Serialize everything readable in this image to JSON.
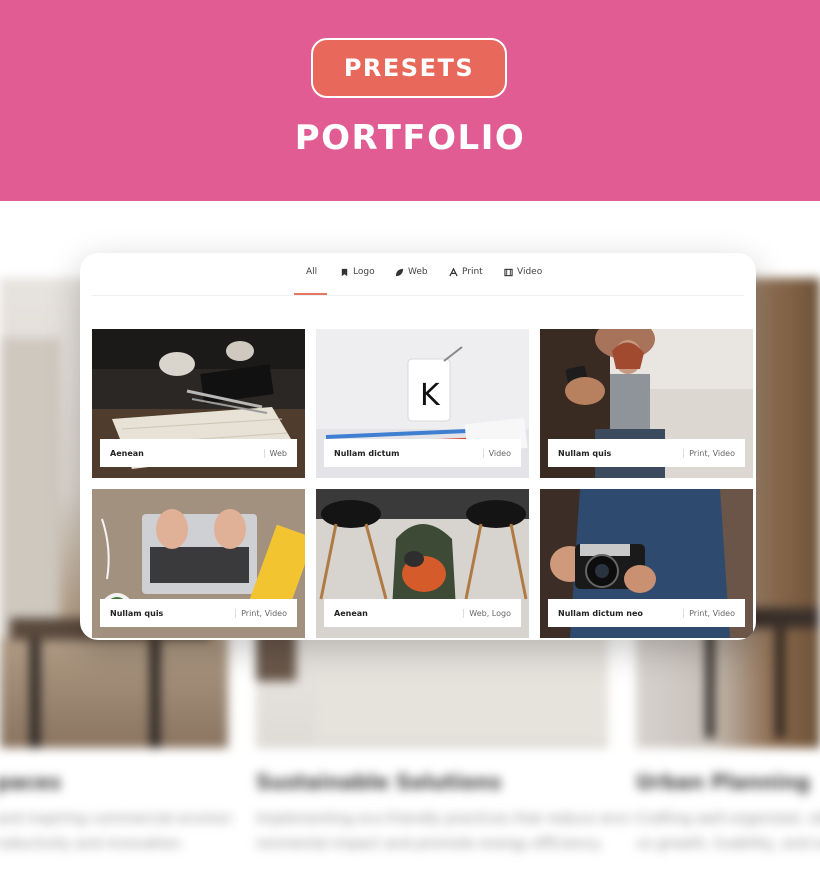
{
  "header": {
    "badge": "PRESETS",
    "title": "PORTFOLIO",
    "band_color": "#e05c93",
    "badge_color": "#e8685b"
  },
  "background": {
    "columns": [
      {
        "title": "paces",
        "desc_line1": "and inspiring commercial environ-",
        "desc_line2": "roductivity and innovation."
      },
      {
        "title": "Sustainable Solutions",
        "desc_line1": "Implementing eco-friendly practices that reduce envi-",
        "desc_line2": "ronmental impact and promote energy efficiency."
      },
      {
        "title": "Urban Planning",
        "desc_line1": "Crafting well-organized, vibr",
        "desc_line2": "ce growth, livability, and sust"
      }
    ]
  },
  "filters": [
    {
      "label": "All",
      "icon": "",
      "active": true
    },
    {
      "label": "Logo",
      "icon": "bookmark-icon"
    },
    {
      "label": "Web",
      "icon": "leaf-icon"
    },
    {
      "label": "Print",
      "icon": "font-icon"
    },
    {
      "label": "Video",
      "icon": "film-icon"
    }
  ],
  "accent_color": "#e2785f",
  "items": [
    {
      "title": "Aenean",
      "category": "Web",
      "image": "desk-notebook-photo"
    },
    {
      "title": "Nullam dictum",
      "category": "Video",
      "image": "mug-pencils-photo"
    },
    {
      "title": "Nullam quis",
      "category": "Print, Video",
      "image": "people-phone-photo"
    },
    {
      "title": "Nullam quis",
      "category": "Print, Video",
      "image": "laptop-typing-photo"
    },
    {
      "title": "Aenean",
      "category": "Web, Logo",
      "image": "backpack-chairs-photo"
    },
    {
      "title": "Nullam dictum neo",
      "category": "Print, Video",
      "image": "camera-man-photo"
    }
  ]
}
